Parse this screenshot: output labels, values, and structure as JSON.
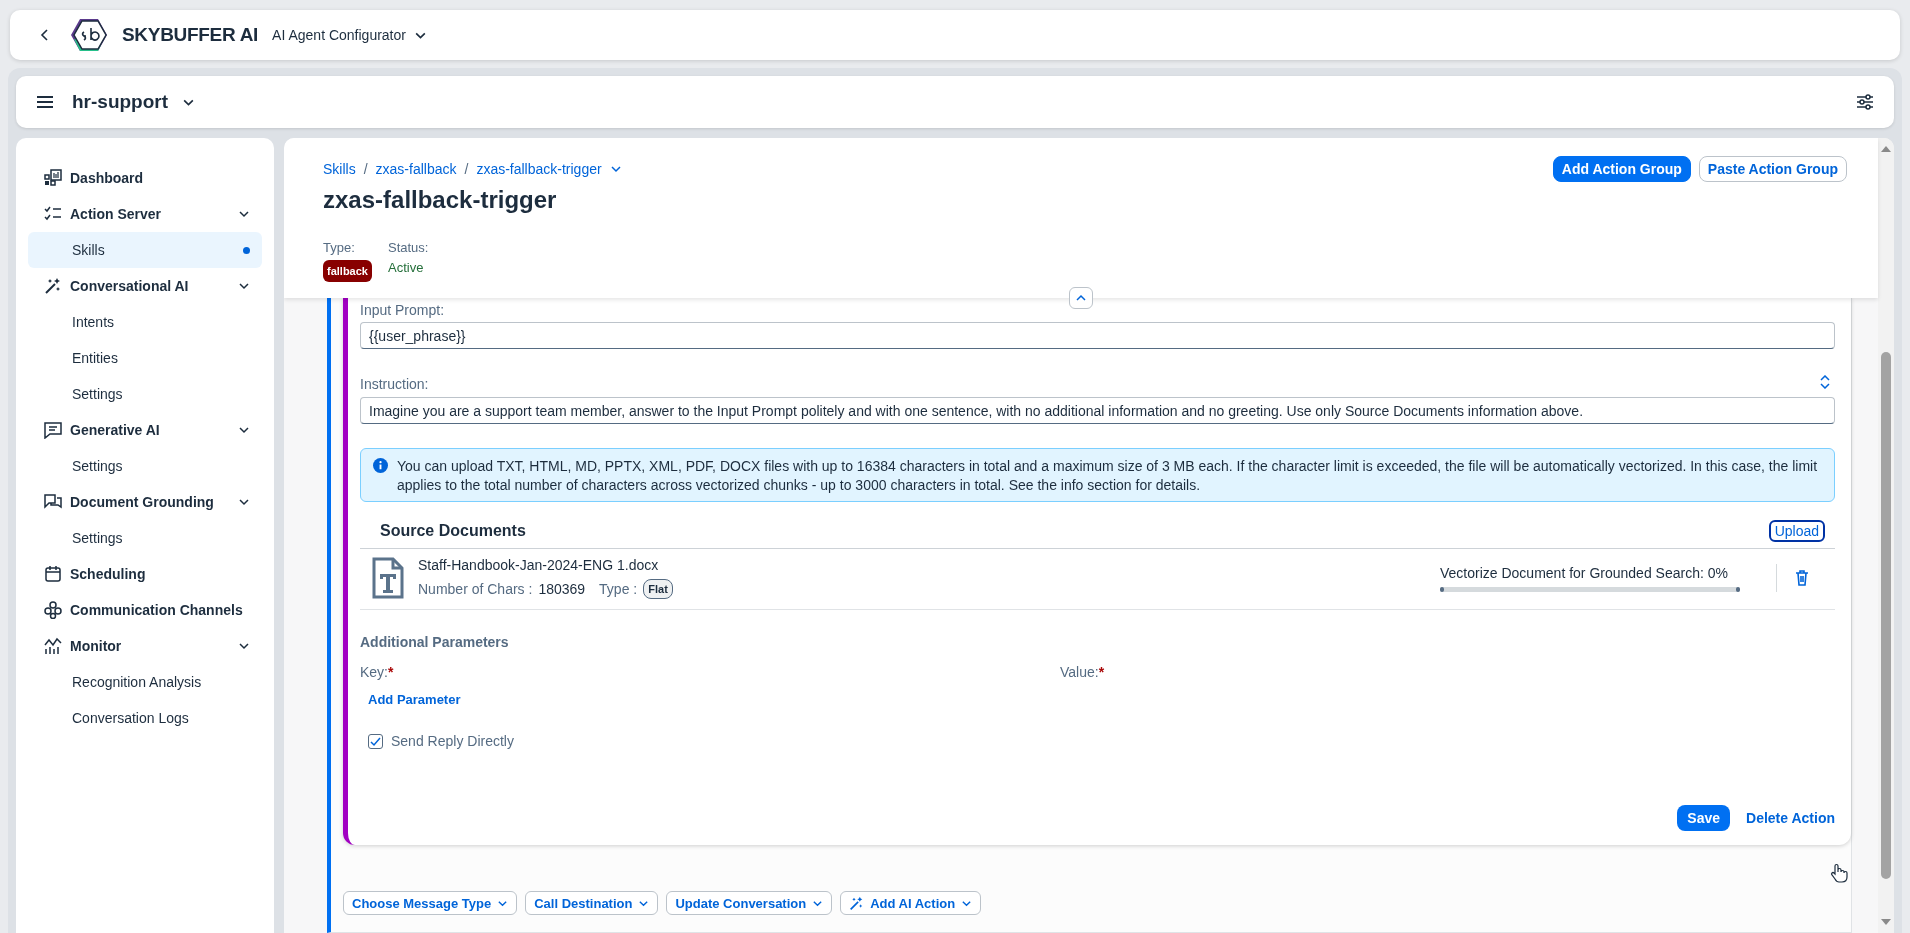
{
  "shell": {
    "brand": "SKYBUFFER AI",
    "app": "AI Agent Configurator"
  },
  "workspace": {
    "name": "hr-support"
  },
  "sidebar": {
    "items": [
      {
        "label": "Dashboard",
        "selected": false
      },
      {
        "label": "Action Server",
        "selected": false,
        "expanded": true,
        "children": [
          {
            "label": "Skills",
            "selected": true
          }
        ]
      },
      {
        "label": "Conversational AI",
        "selected": false,
        "expanded": true,
        "children": [
          {
            "label": "Intents",
            "selected": false
          },
          {
            "label": "Entities",
            "selected": false
          },
          {
            "label": "Settings",
            "selected": false
          }
        ]
      },
      {
        "label": "Generative AI",
        "selected": false,
        "expanded": true,
        "children": [
          {
            "label": "Settings",
            "selected": false
          }
        ]
      },
      {
        "label": "Document Grounding",
        "selected": false,
        "expanded": true,
        "children": [
          {
            "label": "Settings",
            "selected": false
          }
        ]
      },
      {
        "label": "Scheduling",
        "selected": false
      },
      {
        "label": "Communication Channels",
        "selected": false
      },
      {
        "label": "Monitor",
        "selected": false,
        "expanded": true,
        "children": [
          {
            "label": "Recognition Analysis",
            "selected": false
          },
          {
            "label": "Conversation Logs",
            "selected": false
          }
        ]
      }
    ]
  },
  "header": {
    "breadcrumbs": [
      {
        "label": "Skills"
      },
      {
        "separator": "/",
        "label": "zxas-fallback"
      },
      {
        "separator": "/",
        "label": "zxas-fallback-trigger"
      }
    ],
    "title": "zxas-fallback-trigger",
    "buttons": [
      {
        "label": "Add Action Group",
        "kind": "primary"
      },
      {
        "label": "Paste Action Group",
        "kind": "secondary"
      }
    ],
    "type_label": "Type:",
    "type": "fallback",
    "status_label": "Status:",
    "status": "Active"
  },
  "action": {
    "input_prompt": {
      "label": "Input Prompt:",
      "value": "{{user_phrase}}"
    },
    "instruction": {
      "label": "Instruction:",
      "value": "Imagine you are a support team member, answer to the Input Prompt politely and with one sentence, with no additional information and no greeting. Use only Source Documents information above."
    },
    "info": "You can upload TXT, HTML, MD, PPTX, XML, PDF, DOCX files with up to 16384 characters in total and a maximum size of 3 MB each. If the character limit is exceeded, the file will be automatically vectorized. In this case, the limit applies to the total number of characters across vectorized chunks - up to 3000 characters in total. See the info section for details.",
    "source_documents": {
      "title": "Source Documents",
      "upload": "Upload",
      "files": [
        {
          "name": "Staff-Handbook-Jan-2024-ENG 1.docx",
          "chars_label": "Number of Chars :",
          "chars": "180369",
          "type_label": "Type :",
          "type": "Flat",
          "progress_label": "Vectorize Document for Grounded Search: 0%",
          "level": 0
        }
      ]
    },
    "additional_parameters": {
      "title": "Additional Parameters",
      "columns": [
        {
          "label": "Key:",
          "required_mark": "*"
        },
        {
          "label": "Value:",
          "required_mark": "*"
        }
      ],
      "add": "Add Parameter"
    },
    "send_reply": {
      "label": "Send Reply Directly",
      "checked": true
    },
    "save": "Save",
    "delete": "Delete Action"
  },
  "action_menu": [
    {
      "label": "Choose Message Type",
      "kind": "plain"
    },
    {
      "label": "Call Destination",
      "kind": "plain"
    },
    {
      "label": "Update Conversation",
      "kind": "plain"
    },
    {
      "label": "Add AI Action",
      "kind": "ai"
    }
  ]
}
